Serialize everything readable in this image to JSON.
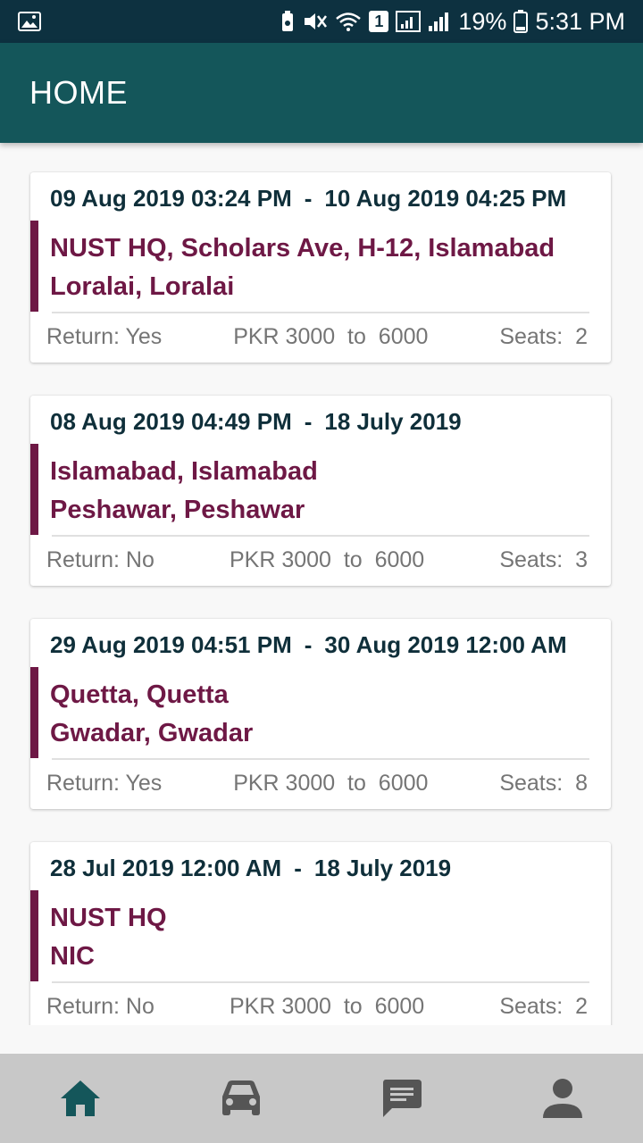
{
  "status_bar": {
    "battery": "19%",
    "time": "5:31 PM",
    "sim_slot": "1"
  },
  "app_bar": {
    "title": "HOME"
  },
  "colors": {
    "app_bar": "#14565a",
    "status_bar": "#0d3140",
    "route": "#6e1845",
    "date": "#0f2f3a",
    "nav_active": "#14565a",
    "nav_inactive": "#555555"
  },
  "rides": [
    {
      "start": "09 Aug 2019 03:24 PM",
      "separator": "-",
      "end": "10 Aug 2019 04:25 PM",
      "from": "NUST HQ, Scholars Ave, H-12, Islamabad",
      "to": "Loralai, Loralai",
      "return": "Return: Yes",
      "price": "PKR 3000  to  6000",
      "seats": "Seats:  2"
    },
    {
      "start": "08 Aug 2019 04:49 PM",
      "separator": "-",
      "end": "18 July 2019",
      "from": "Islamabad, Islamabad",
      "to": "Peshawar, Peshawar",
      "return": "Return: No",
      "price": "PKR 3000  to  6000",
      "seats": "Seats:  3"
    },
    {
      "start": "29 Aug 2019 04:51 PM",
      "separator": "-",
      "end": "30 Aug 2019 12:00 AM",
      "from": "Quetta, Quetta",
      "to": "Gwadar, Gwadar",
      "return": "Return: Yes",
      "price": "PKR 3000  to  6000",
      "seats": "Seats:  8"
    },
    {
      "start": "28 Jul 2019 12:00 AM",
      "separator": "-",
      "end": "18 July 2019",
      "from": "NUST HQ",
      "to": "NIC",
      "return": "Return: No",
      "price": "PKR 3000  to  6000",
      "seats": "Seats:  2"
    }
  ],
  "bottom_nav": [
    {
      "icon": "home-icon",
      "active": true
    },
    {
      "icon": "car-icon",
      "active": false
    },
    {
      "icon": "chat-icon",
      "active": false
    },
    {
      "icon": "person-icon",
      "active": false
    }
  ]
}
